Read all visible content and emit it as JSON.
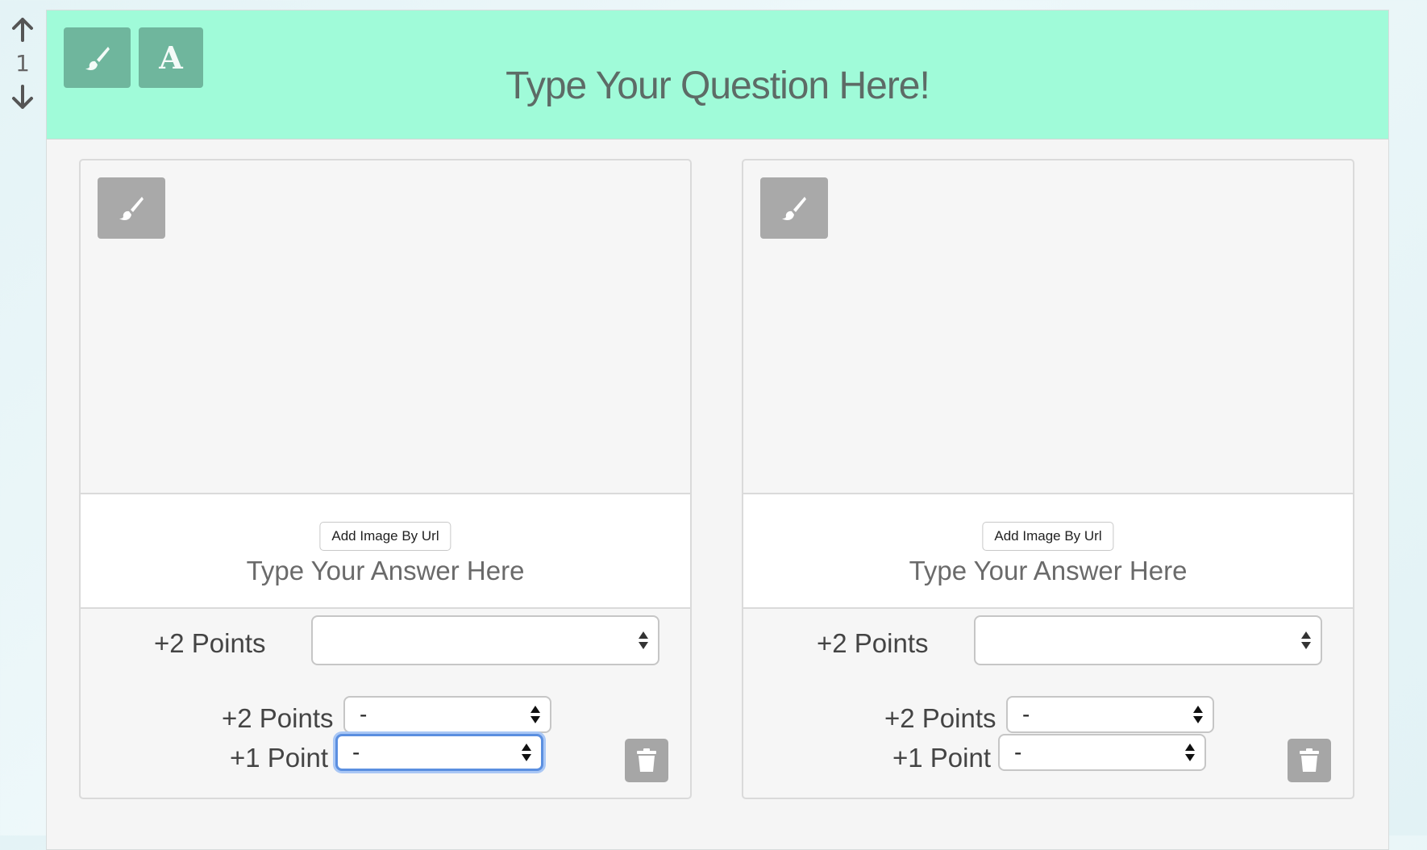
{
  "reorder": {
    "index": "1"
  },
  "question": {
    "title": "Type Your Question Here!",
    "text_tool_letter": "A"
  },
  "answers": [
    {
      "add_image_label": "Add Image By Url",
      "answer_placeholder": "Type Your Answer Here",
      "main_points_label": "+2 Points",
      "main_select_value": "",
      "rows": [
        {
          "label": "+2 Points",
          "value": "-"
        },
        {
          "label": "+1 Point",
          "value": "-"
        }
      ]
    },
    {
      "add_image_label": "Add Image By Url",
      "answer_placeholder": "Type Your Answer Here",
      "main_points_label": "+2 Points",
      "main_select_value": "",
      "rows": [
        {
          "label": "+2 Points",
          "value": "-"
        },
        {
          "label": "+1 Point",
          "value": "-"
        }
      ]
    }
  ],
  "colors": {
    "header_bg": "#a0fbd9",
    "tool_button": "#6fb69d",
    "gray_button": "#a9a9a9",
    "focus_ring": "#5b8fe0"
  },
  "icons": {
    "move_up": "arrow-up-icon",
    "move_down": "arrow-down-icon",
    "paint": "paintbrush-icon",
    "delete": "trash-icon",
    "select": "updown-chevron-icon"
  }
}
